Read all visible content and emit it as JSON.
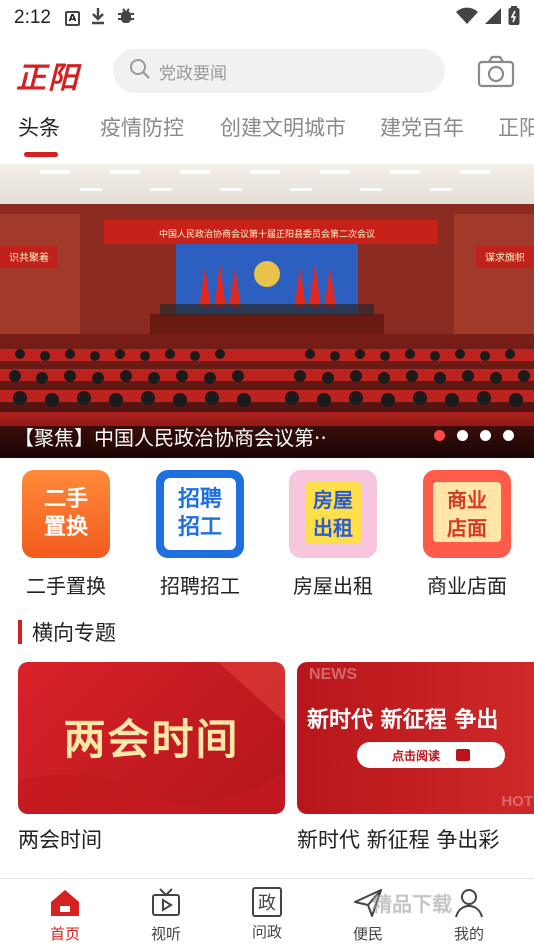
{
  "status_bar": {
    "time": "2:12"
  },
  "header": {
    "logo_text": "正阳",
    "search_placeholder": "党政要闻"
  },
  "tabs": [
    {
      "label": "头条",
      "active": true
    },
    {
      "label": "疫情防控"
    },
    {
      "label": "创建文明城市"
    },
    {
      "label": "建党百年"
    },
    {
      "label": "正阳"
    }
  ],
  "banner": {
    "caption": "【聚焦】中国人民政治协商会议第··",
    "stage_banner_text": "中国人民政治协商会议第十届正阳县委员会第二次会议",
    "side_banner_left": "识共聚着",
    "side_banner_right": "谋求旗帜",
    "slide_count": 4,
    "active_slide": 1
  },
  "services": [
    {
      "label": "二手置换",
      "icon_text": "二手\n置换",
      "icon": "exchange-icon"
    },
    {
      "label": "招聘招工",
      "icon_text": "招聘\n招工",
      "icon": "recruit-icon"
    },
    {
      "label": "房屋出租",
      "icon_text": "房屋\n出租",
      "icon": "house-rent-icon"
    },
    {
      "label": "商业店面",
      "icon_text": "商业\n店面",
      "icon": "shop-icon"
    }
  ],
  "section": {
    "title": "横向专题"
  },
  "topics": [
    {
      "caption": "两会时间",
      "image_text": "两会时间"
    },
    {
      "caption": "新时代 新征程 争出彩",
      "image_text": "新时代 新征程 争出",
      "tag": "NEWS",
      "tag2": "HOT",
      "button": "点击阅读"
    }
  ],
  "bottom_nav": [
    {
      "label": "首页",
      "icon": "home-icon",
      "active": true
    },
    {
      "label": "视听",
      "icon": "tv-icon"
    },
    {
      "label": "问政",
      "icon": "politics-icon",
      "icon_text": "政"
    },
    {
      "label": "便民",
      "icon": "send-icon"
    },
    {
      "label": "我的",
      "icon": "user-icon"
    }
  ],
  "watermark": "精品下载",
  "colors": {
    "accent": "#d62121",
    "inactive_tab": "#8a8a8a"
  }
}
